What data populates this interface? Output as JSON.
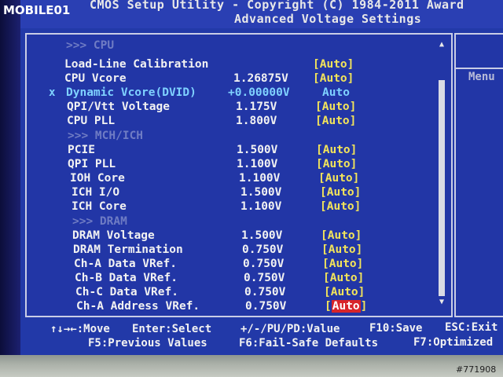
{
  "header": {
    "line1": "CMOS Setup Utility - Copyright (C) 1984-2011 Award",
    "line2": "Advanced Voltage Settings"
  },
  "side_panel": {
    "menu_label": "Menu"
  },
  "rows": [
    {
      "label": ">>> CPU",
      "type": "section"
    },
    {
      "label": "Load-Line Calibration",
      "value": "",
      "option": "[Auto]"
    },
    {
      "label": "CPU Vcore",
      "value": "1.26875V",
      "option": "[Auto]"
    },
    {
      "label": "Dynamic Vcore(DVID)",
      "value": "+0.00000V",
      "option": "Auto",
      "type": "starred",
      "mark": "x"
    },
    {
      "label": "QPI/Vtt Voltage",
      "value": "1.175V",
      "option": "[Auto]"
    },
    {
      "label": "CPU PLL",
      "value": "1.800V",
      "option": "[Auto]"
    },
    {
      "label": ">>> MCH/ICH",
      "type": "section"
    },
    {
      "label": "PCIE",
      "value": "1.500V",
      "option": "[Auto]"
    },
    {
      "label": "QPI PLL",
      "value": "1.100V",
      "option": "[Auto]"
    },
    {
      "label": "IOH Core",
      "value": "1.100V",
      "option": "[Auto]"
    },
    {
      "label": "ICH I/O",
      "value": "1.500V",
      "option": "[Auto]"
    },
    {
      "label": "ICH Core",
      "value": "1.100V",
      "option": "[Auto]"
    },
    {
      "label": ">>> DRAM",
      "type": "section"
    },
    {
      "label": "DRAM Voltage",
      "value": "1.500V",
      "option": "[Auto]"
    },
    {
      "label": "DRAM Termination",
      "value": "0.750V",
      "option": "[Auto]"
    },
    {
      "label": "Ch-A Data VRef.",
      "value": "0.750V",
      "option": "[Auto]"
    },
    {
      "label": "Ch-B Data VRef.",
      "value": "0.750V",
      "option": "[Auto]"
    },
    {
      "label": "Ch-C Data VRef.",
      "value": "0.750V",
      "option": "[Auto]"
    },
    {
      "label": "Ch-A Address VRef.",
      "value": "0.750V",
      "option": "Auto",
      "type": "selected"
    }
  ],
  "footer": {
    "move": "↑↓→←:Move",
    "select": "Enter:Select",
    "value": "+/-/PU/PD:Value",
    "save": "F10:Save",
    "exit": "ESC:Exit",
    "prev": "F5:Previous Values",
    "failsafe": "F6:Fail-Safe Defaults",
    "optimized": "F7:Optimized"
  },
  "watermark": {
    "logo_text": "MOBILE01",
    "photo_id": "#771908"
  },
  "colors": {
    "background": "#2239a8",
    "option_yellow": "#f3e45a",
    "selected_red": "#d8242a",
    "starred_cyan": "#7fd2ff",
    "section_dim": "#6f7cc4"
  },
  "icons": {
    "scroll_up": "arrow-up-icon",
    "scroll_down": "arrow-down-icon"
  }
}
